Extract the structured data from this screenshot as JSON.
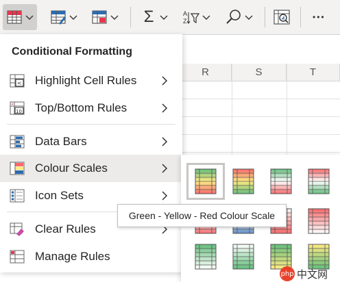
{
  "toolbar": {
    "buttons": [
      {
        "name": "conditional-formatting",
        "icon": "conditional-format-icon"
      },
      {
        "name": "format-as-table",
        "icon": "format-table-icon"
      },
      {
        "name": "cell-styles",
        "icon": "cell-styles-icon"
      },
      {
        "name": "autosum",
        "icon": "sigma-icon",
        "glyph": "Σ"
      },
      {
        "name": "sort-filter",
        "icon": "sort-filter-icon"
      },
      {
        "name": "find",
        "icon": "search-icon"
      },
      {
        "name": "analyze-data",
        "icon": "analyze-data-icon"
      },
      {
        "name": "more",
        "icon": "more-icon",
        "glyph": "•••"
      }
    ]
  },
  "sheet": {
    "columns": [
      "R",
      "S",
      "T"
    ]
  },
  "menu": {
    "title": "Conditional Formatting",
    "items": [
      {
        "label": "Highlight Cell Rules",
        "icon": "highlight-cells-icon",
        "has_submenu": true
      },
      {
        "label": "Top/Bottom Rules",
        "icon": "top-bottom-icon",
        "has_submenu": true
      },
      {
        "label": "Data Bars",
        "icon": "data-bars-icon",
        "has_submenu": true
      },
      {
        "label": "Colour Scales",
        "icon": "colour-scales-icon",
        "has_submenu": true,
        "active": true
      },
      {
        "label": "Icon Sets",
        "icon": "icon-sets-icon",
        "has_submenu": true
      },
      {
        "label": "Clear Rules",
        "icon": "clear-rules-icon",
        "has_submenu": true
      },
      {
        "label": "Manage Rules",
        "icon": "manage-rules-icon",
        "has_submenu": false
      }
    ],
    "top_bottom_icon_number": "10"
  },
  "colour_scales": {
    "swatches": [
      {
        "bands": [
          "#63be7b",
          "#ffeb84",
          "#f8696b"
        ]
      },
      {
        "bands": [
          "#f8696b",
          "#ffeb84",
          "#63be7b"
        ]
      },
      {
        "bands": [
          "#63be7b",
          "#ffffff",
          "#f8696b"
        ]
      },
      {
        "bands": [
          "#f8696b",
          "#ffffff",
          "#63be7b"
        ]
      },
      {
        "bands": [
          "#5a8ac6",
          "#ffffff",
          "#f8696b"
        ]
      },
      {
        "bands": [
          "#f8696b",
          "#ffffff",
          "#5a8ac6"
        ]
      },
      {
        "bands": [
          "#ffffff",
          "#f8696b"
        ]
      },
      {
        "bands": [
          "#f8696b",
          "#ffffff"
        ]
      },
      {
        "bands": [
          "#63be7b",
          "#ffffff"
        ]
      },
      {
        "bands": [
          "#ffffff",
          "#63be7b"
        ]
      },
      {
        "bands": [
          "#63be7b",
          "#ffeb84"
        ]
      },
      {
        "bands": [
          "#ffeb84",
          "#63be7b"
        ]
      }
    ],
    "selected_index": 0
  },
  "tooltip": "Green - Yellow - Red Colour Scale",
  "watermark": {
    "logo": "php",
    "text": "中文网"
  }
}
